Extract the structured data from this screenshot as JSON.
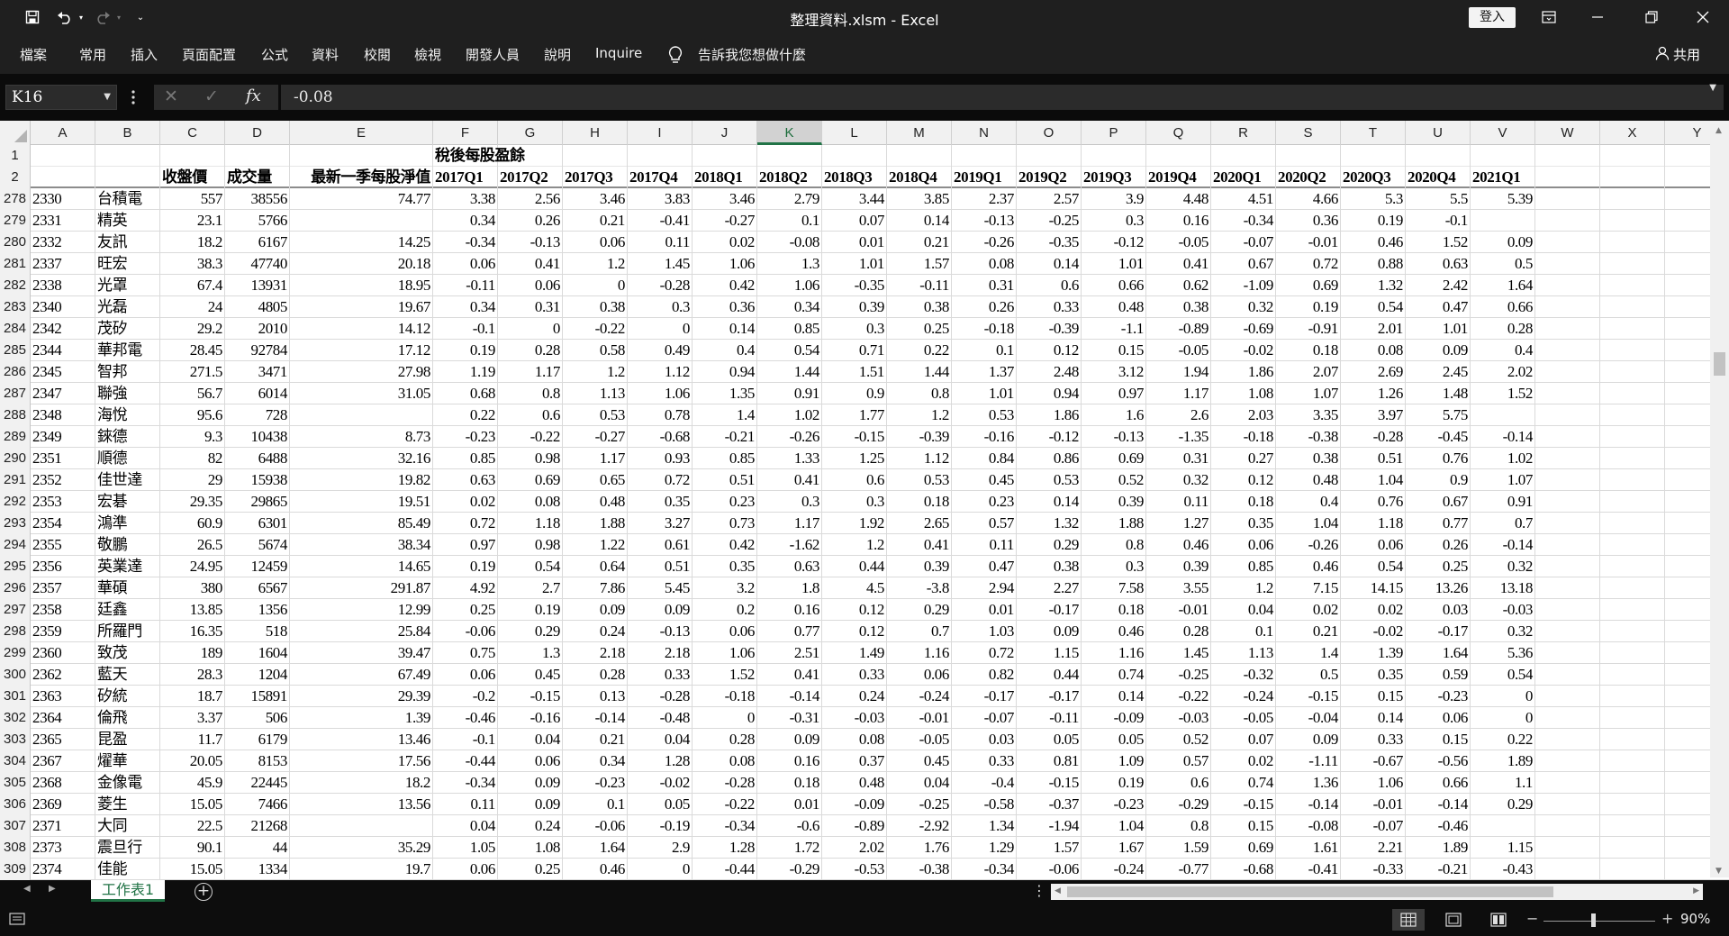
{
  "window": {
    "title": "整理資料.xlsm  -  Excel",
    "signin_label": "登入"
  },
  "ribbon": {
    "tabs": [
      "檔案",
      "常用",
      "插入",
      "頁面配置",
      "公式",
      "資料",
      "校閱",
      "檢視",
      "開發人員",
      "說明",
      "Inquire"
    ],
    "tell_me": "告訴我您想做什麼",
    "share": "共用"
  },
  "formula_bar": {
    "name_box": "K16",
    "formula": "-0.08"
  },
  "grid": {
    "selected_column": "K",
    "column_letters": [
      "A",
      "B",
      "C",
      "D",
      "E",
      "F",
      "G",
      "H",
      "I",
      "J",
      "K",
      "L",
      "M",
      "N",
      "O",
      "P",
      "Q",
      "R",
      "S",
      "T",
      "U",
      "V",
      "W",
      "X",
      "Y"
    ],
    "header_row1": [
      "",
      "",
      "",
      "",
      "",
      "稅後每股盈餘",
      "",
      "",
      "",
      "",
      "",
      "",
      "",
      "",
      "",
      "",
      "",
      "",
      "",
      "",
      "",
      "",
      "",
      "",
      ""
    ],
    "header_row2": [
      "",
      "",
      "收盤價",
      "成交量",
      "最新一季每股淨值",
      "2017Q1",
      "2017Q2",
      "2017Q3",
      "2017Q4",
      "2018Q1",
      "2018Q2",
      "2018Q3",
      "2018Q4",
      "2019Q1",
      "2019Q2",
      "2019Q3",
      "2019Q4",
      "2020Q1",
      "2020Q2",
      "2020Q3",
      "2020Q4",
      "2021Q1"
    ],
    "rows": [
      {
        "n": "278",
        "c": [
          "2330",
          "台積電",
          "557",
          "38556",
          "74.77",
          "3.38",
          "2.56",
          "3.46",
          "3.83",
          "3.46",
          "2.79",
          "3.44",
          "3.85",
          "2.37",
          "2.57",
          "3.9",
          "4.48",
          "4.51",
          "4.66",
          "5.3",
          "5.5",
          "5.39"
        ]
      },
      {
        "n": "279",
        "c": [
          "2331",
          "精英",
          "23.1",
          "5766",
          "",
          "0.34",
          "0.26",
          "0.21",
          "-0.41",
          "-0.27",
          "0.1",
          "0.07",
          "0.14",
          "-0.13",
          "-0.25",
          "0.3",
          "0.16",
          "-0.34",
          "0.36",
          "0.19",
          "-0.1",
          ""
        ]
      },
      {
        "n": "280",
        "c": [
          "2332",
          "友訊",
          "18.2",
          "6167",
          "14.25",
          "-0.34",
          "-0.13",
          "0.06",
          "0.11",
          "0.02",
          "-0.08",
          "0.01",
          "0.21",
          "-0.26",
          "-0.35",
          "-0.12",
          "-0.05",
          "-0.07",
          "-0.01",
          "0.46",
          "1.52",
          "0.09"
        ]
      },
      {
        "n": "281",
        "c": [
          "2337",
          "旺宏",
          "38.3",
          "47740",
          "20.18",
          "0.06",
          "0.41",
          "1.2",
          "1.45",
          "1.06",
          "1.3",
          "1.01",
          "1.57",
          "0.08",
          "0.14",
          "1.01",
          "0.41",
          "0.67",
          "0.72",
          "0.88",
          "0.63",
          "0.5"
        ]
      },
      {
        "n": "282",
        "c": [
          "2338",
          "光罩",
          "67.4",
          "13931",
          "18.95",
          "-0.11",
          "0.06",
          "0",
          "-0.28",
          "0.42",
          "1.06",
          "-0.35",
          "-0.11",
          "0.31",
          "0.6",
          "0.66",
          "0.62",
          "-1.09",
          "0.69",
          "1.32",
          "2.42",
          "1.64"
        ]
      },
      {
        "n": "283",
        "c": [
          "2340",
          "光磊",
          "24",
          "4805",
          "19.67",
          "0.34",
          "0.31",
          "0.38",
          "0.3",
          "0.36",
          "0.34",
          "0.39",
          "0.38",
          "0.26",
          "0.33",
          "0.48",
          "0.38",
          "0.32",
          "0.19",
          "0.54",
          "0.47",
          "0.66"
        ]
      },
      {
        "n": "284",
        "c": [
          "2342",
          "茂矽",
          "29.2",
          "2010",
          "14.12",
          "-0.1",
          "0",
          "-0.22",
          "0",
          "0.14",
          "0.85",
          "0.3",
          "0.25",
          "-0.18",
          "-0.39",
          "-1.1",
          "-0.89",
          "-0.69",
          "-0.91",
          "2.01",
          "1.01",
          "0.28"
        ]
      },
      {
        "n": "285",
        "c": [
          "2344",
          "華邦電",
          "28.45",
          "92784",
          "17.12",
          "0.19",
          "0.28",
          "0.58",
          "0.49",
          "0.4",
          "0.54",
          "0.71",
          "0.22",
          "0.1",
          "0.12",
          "0.15",
          "-0.05",
          "-0.02",
          "0.18",
          "0.08",
          "0.09",
          "0.4"
        ]
      },
      {
        "n": "286",
        "c": [
          "2345",
          "智邦",
          "271.5",
          "3471",
          "27.98",
          "1.19",
          "1.17",
          "1.2",
          "1.12",
          "0.94",
          "1.44",
          "1.51",
          "1.44",
          "1.37",
          "2.48",
          "3.12",
          "1.94",
          "1.86",
          "2.07",
          "2.69",
          "2.45",
          "2.02"
        ]
      },
      {
        "n": "287",
        "c": [
          "2347",
          "聯強",
          "56.7",
          "6014",
          "31.05",
          "0.68",
          "0.8",
          "1.13",
          "1.06",
          "1.35",
          "0.91",
          "0.9",
          "0.8",
          "1.01",
          "0.94",
          "0.97",
          "1.17",
          "1.08",
          "1.07",
          "1.26",
          "1.48",
          "1.52"
        ]
      },
      {
        "n": "288",
        "c": [
          "2348",
          "海悅",
          "95.6",
          "728",
          "",
          "0.22",
          "0.6",
          "0.53",
          "0.78",
          "1.4",
          "1.02",
          "1.77",
          "1.2",
          "0.53",
          "1.86",
          "1.6",
          "2.6",
          "2.03",
          "3.35",
          "3.97",
          "5.75",
          ""
        ]
      },
      {
        "n": "289",
        "c": [
          "2349",
          "錸德",
          "9.3",
          "10438",
          "8.73",
          "-0.23",
          "-0.22",
          "-0.27",
          "-0.68",
          "-0.21",
          "-0.26",
          "-0.15",
          "-0.39",
          "-0.16",
          "-0.12",
          "-0.13",
          "-1.35",
          "-0.18",
          "-0.38",
          "-0.28",
          "-0.45",
          "-0.14"
        ]
      },
      {
        "n": "290",
        "c": [
          "2351",
          "順德",
          "82",
          "6488",
          "32.16",
          "0.85",
          "0.98",
          "1.17",
          "0.93",
          "0.85",
          "1.33",
          "1.25",
          "1.12",
          "0.84",
          "0.86",
          "0.69",
          "0.31",
          "0.27",
          "0.38",
          "0.51",
          "0.76",
          "1.02"
        ]
      },
      {
        "n": "291",
        "c": [
          "2352",
          "佳世達",
          "29",
          "15938",
          "19.82",
          "0.63",
          "0.69",
          "0.65",
          "0.72",
          "0.51",
          "0.41",
          "0.6",
          "0.53",
          "0.45",
          "0.53",
          "0.52",
          "0.32",
          "0.12",
          "0.48",
          "1.04",
          "0.9",
          "1.07"
        ]
      },
      {
        "n": "292",
        "c": [
          "2353",
          "宏碁",
          "29.35",
          "29865",
          "19.51",
          "0.02",
          "0.08",
          "0.48",
          "0.35",
          "0.23",
          "0.3",
          "0.3",
          "0.18",
          "0.23",
          "0.14",
          "0.39",
          "0.11",
          "0.18",
          "0.4",
          "0.76",
          "0.67",
          "0.91"
        ]
      },
      {
        "n": "293",
        "c": [
          "2354",
          "鴻準",
          "60.9",
          "6301",
          "85.49",
          "0.72",
          "1.18",
          "1.88",
          "3.27",
          "0.73",
          "1.17",
          "1.92",
          "2.65",
          "0.57",
          "1.32",
          "1.88",
          "1.27",
          "0.35",
          "1.04",
          "1.18",
          "0.77",
          "0.7"
        ]
      },
      {
        "n": "294",
        "c": [
          "2355",
          "敬鵬",
          "26.5",
          "5674",
          "38.34",
          "0.97",
          "0.98",
          "1.22",
          "0.61",
          "0.42",
          "-1.62",
          "1.2",
          "0.41",
          "0.11",
          "0.29",
          "0.8",
          "0.46",
          "0.06",
          "-0.26",
          "0.06",
          "0.26",
          "-0.14"
        ]
      },
      {
        "n": "295",
        "c": [
          "2356",
          "英業達",
          "24.95",
          "12459",
          "14.65",
          "0.19",
          "0.54",
          "0.64",
          "0.51",
          "0.35",
          "0.63",
          "0.44",
          "0.39",
          "0.47",
          "0.38",
          "0.3",
          "0.39",
          "0.85",
          "0.46",
          "0.54",
          "0.25",
          "0.32"
        ]
      },
      {
        "n": "296",
        "c": [
          "2357",
          "華碩",
          "380",
          "6567",
          "291.87",
          "4.92",
          "2.7",
          "7.86",
          "5.45",
          "3.2",
          "1.8",
          "4.5",
          "-3.8",
          "2.94",
          "2.27",
          "7.58",
          "3.55",
          "1.2",
          "7.15",
          "14.15",
          "13.26",
          "13.18"
        ]
      },
      {
        "n": "297",
        "c": [
          "2358",
          "廷鑫",
          "13.85",
          "1356",
          "12.99",
          "0.25",
          "0.19",
          "0.09",
          "0.09",
          "0.2",
          "0.16",
          "0.12",
          "0.29",
          "0.01",
          "-0.17",
          "0.18",
          "-0.01",
          "0.04",
          "0.02",
          "0.02",
          "0.03",
          "-0.03"
        ]
      },
      {
        "n": "298",
        "c": [
          "2359",
          "所羅門",
          "16.35",
          "518",
          "25.84",
          "-0.06",
          "0.29",
          "0.24",
          "-0.13",
          "0.06",
          "0.77",
          "0.12",
          "0.7",
          "1.03",
          "0.09",
          "0.46",
          "0.28",
          "0.1",
          "0.21",
          "-0.02",
          "-0.17",
          "0.32"
        ]
      },
      {
        "n": "299",
        "c": [
          "2360",
          "致茂",
          "189",
          "1604",
          "39.47",
          "0.75",
          "1.3",
          "2.18",
          "2.18",
          "1.06",
          "2.51",
          "1.49",
          "1.16",
          "0.72",
          "1.15",
          "1.16",
          "1.45",
          "1.13",
          "1.4",
          "1.39",
          "1.64",
          "5.36"
        ]
      },
      {
        "n": "300",
        "c": [
          "2362",
          "藍天",
          "28.3",
          "1204",
          "67.49",
          "0.06",
          "0.45",
          "0.28",
          "0.33",
          "1.52",
          "0.41",
          "0.33",
          "0.06",
          "0.82",
          "0.44",
          "0.74",
          "-0.25",
          "-0.32",
          "0.5",
          "0.35",
          "0.59",
          "0.54"
        ]
      },
      {
        "n": "301",
        "c": [
          "2363",
          "矽統",
          "18.7",
          "15891",
          "29.39",
          "-0.2",
          "-0.15",
          "0.13",
          "-0.28",
          "-0.18",
          "-0.14",
          "0.24",
          "-0.24",
          "-0.17",
          "-0.17",
          "0.14",
          "-0.22",
          "-0.24",
          "-0.15",
          "0.15",
          "-0.23",
          "0"
        ]
      },
      {
        "n": "302",
        "c": [
          "2364",
          "倫飛",
          "3.37",
          "506",
          "1.39",
          "-0.46",
          "-0.16",
          "-0.14",
          "-0.48",
          "0",
          "-0.31",
          "-0.03",
          "-0.01",
          "-0.07",
          "-0.11",
          "-0.09",
          "-0.03",
          "-0.05",
          "-0.04",
          "0.14",
          "0.06",
          "0"
        ]
      },
      {
        "n": "303",
        "c": [
          "2365",
          "昆盈",
          "11.7",
          "6179",
          "13.46",
          "-0.1",
          "0.04",
          "0.21",
          "0.04",
          "0.28",
          "0.09",
          "0.08",
          "-0.05",
          "0.03",
          "0.05",
          "0.05",
          "0.52",
          "0.07",
          "0.09",
          "0.33",
          "0.15",
          "0.22"
        ]
      },
      {
        "n": "304",
        "c": [
          "2367",
          "燿華",
          "20.05",
          "8153",
          "17.56",
          "-0.44",
          "0.06",
          "0.34",
          "1.28",
          "0.08",
          "0.16",
          "0.37",
          "0.45",
          "0.33",
          "0.81",
          "1.09",
          "0.57",
          "0.02",
          "-1.11",
          "-0.67",
          "-0.56",
          "1.89"
        ]
      },
      {
        "n": "305",
        "c": [
          "2368",
          "金像電",
          "45.9",
          "22445",
          "18.2",
          "-0.34",
          "0.09",
          "-0.23",
          "-0.02",
          "-0.28",
          "0.18",
          "0.48",
          "0.04",
          "-0.4",
          "-0.15",
          "0.19",
          "0.6",
          "0.74",
          "1.36",
          "1.06",
          "0.66",
          "1.1"
        ]
      },
      {
        "n": "306",
        "c": [
          "2369",
          "菱生",
          "15.05",
          "7466",
          "13.56",
          "0.11",
          "0.09",
          "0.1",
          "0.05",
          "-0.22",
          "0.01",
          "-0.09",
          "-0.25",
          "-0.58",
          "-0.37",
          "-0.23",
          "-0.29",
          "-0.15",
          "-0.14",
          "-0.01",
          "-0.14",
          "0.29"
        ]
      },
      {
        "n": "307",
        "c": [
          "2371",
          "大同",
          "22.5",
          "21268",
          "",
          "0.04",
          "0.24",
          "-0.06",
          "-0.19",
          "-0.34",
          "-0.6",
          "-0.89",
          "-2.92",
          "1.34",
          "-1.94",
          "1.04",
          "0.8",
          "0.15",
          "-0.08",
          "-0.07",
          "-0.46",
          ""
        ]
      },
      {
        "n": "308",
        "c": [
          "2373",
          "震旦行",
          "90.1",
          "44",
          "35.29",
          "1.05",
          "1.08",
          "1.64",
          "2.9",
          "1.28",
          "1.72",
          "2.02",
          "1.76",
          "1.29",
          "1.57",
          "1.67",
          "1.59",
          "0.69",
          "1.61",
          "2.21",
          "1.89",
          "1.15"
        ]
      },
      {
        "n": "309",
        "c": [
          "2374",
          "佳能",
          "15.05",
          "1334",
          "19.7",
          "0.06",
          "0.25",
          "0.46",
          "0",
          "-0.44",
          "-0.29",
          "-0.53",
          "-0.38",
          "-0.34",
          "-0.06",
          "-0.24",
          "-0.77",
          "-0.68",
          "-0.41",
          "-0.33",
          "-0.21",
          "-0.43"
        ]
      }
    ]
  },
  "sheets": {
    "active": "工作表1"
  },
  "status": {
    "zoom": "90%",
    "zoom_level_percent": 90
  }
}
